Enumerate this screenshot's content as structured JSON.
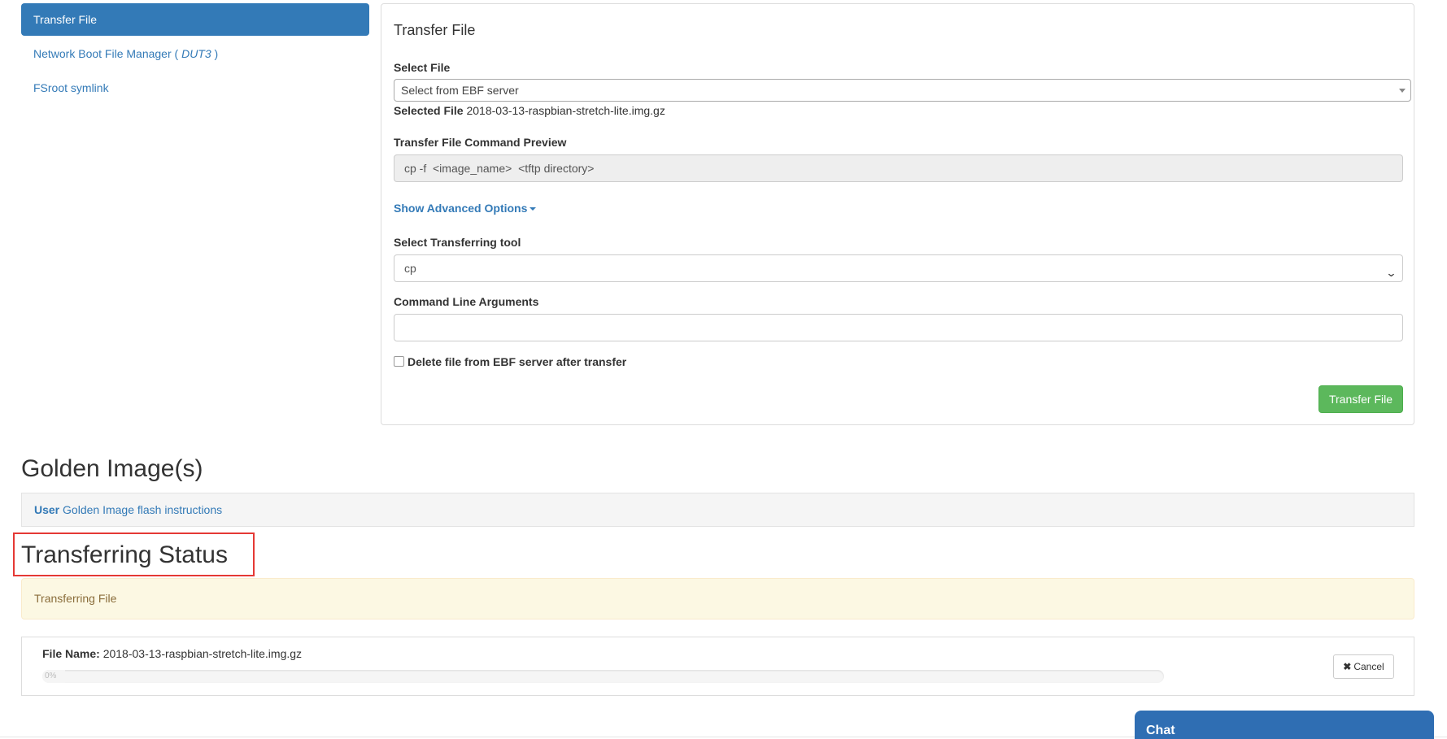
{
  "sidebar": {
    "items": [
      {
        "label": "Transfer File",
        "active": true
      },
      {
        "label_prefix": "Network Boot File Manager ( ",
        "label_em": "DUT3",
        "label_suffix": " )"
      },
      {
        "label": "FSroot symlink"
      }
    ]
  },
  "transfer_panel": {
    "title": "Transfer File",
    "select_file_label": "Select File",
    "select_file_value": "Select from EBF server",
    "selected_file_label": "Selected File",
    "selected_file_value": "2018-03-13-raspbian-stretch-lite.img.gz",
    "preview_label": "Transfer File Command Preview",
    "preview_value": "cp -f  <image_name>  <tftp directory>",
    "advanced_link": "Show Advanced Options",
    "tool_label": "Select Transferring tool",
    "tool_value": "cp",
    "args_label": "Command Line Arguments",
    "args_value": "",
    "delete_checkbox_label": "Delete file from EBF server after transfer",
    "delete_checked": false,
    "transfer_button": "Transfer File"
  },
  "golden": {
    "heading": "Golden Image(s)",
    "user_label": "User",
    "link_text": "Golden Image flash instructions"
  },
  "status": {
    "heading": "Transferring Status",
    "alert_text": "Transferring File",
    "file_name_label": "File Name:",
    "file_name_value": "2018-03-13-raspbian-stretch-lite.img.gz",
    "progress_text": "0%",
    "progress_value": 0,
    "cancel_button": "Cancel"
  },
  "chat": {
    "label": "Chat"
  },
  "colors": {
    "primary": "#337ab7",
    "success": "#5cb85c",
    "warning_bg": "#fcf8e3",
    "highlight": "#e53935"
  }
}
